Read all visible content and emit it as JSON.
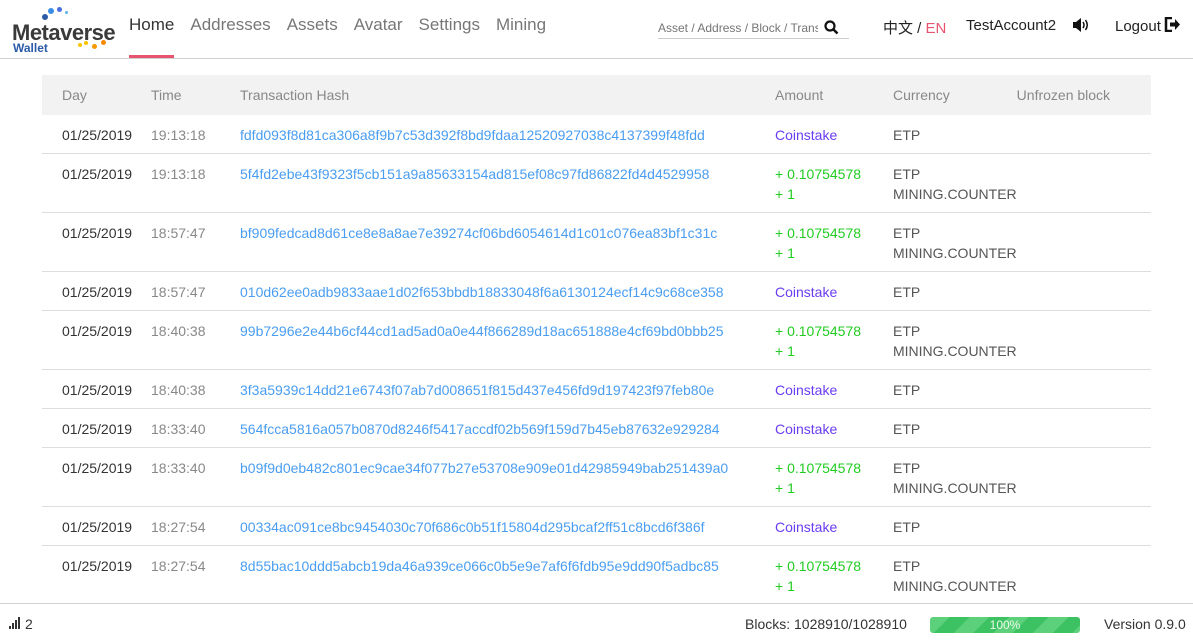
{
  "header": {
    "logo_text": "Metaverse",
    "logo_sub": "Wallet",
    "nav": [
      {
        "label": "Home",
        "active": true
      },
      {
        "label": "Addresses"
      },
      {
        "label": "Assets"
      },
      {
        "label": "Avatar"
      },
      {
        "label": "Settings"
      },
      {
        "label": "Mining"
      }
    ],
    "search_placeholder": "Asset / Address / Block / Transaction",
    "lang_zh": "中文",
    "lang_sep": " / ",
    "lang_en": "EN",
    "account": "TestAccount2",
    "logout": "Logout",
    "accent": "#e8546f"
  },
  "table": {
    "columns": [
      "Day",
      "Time",
      "Transaction Hash",
      "Amount",
      "Currency",
      "Unfrozen block"
    ],
    "rows": [
      {
        "day": "01/25/2019",
        "time": "19:13:18",
        "hash": "fdfd093f8d81ca306a8f9b7c53d392f8bd9fdaa12520927038c4137399f48fdd",
        "amounts": [
          "Coinstake"
        ],
        "currencies": [
          "ETP"
        ]
      },
      {
        "day": "01/25/2019",
        "time": "19:13:18",
        "hash": "5f4fd2ebe43f9323f5cb151a9a85633154ad815ef08c97fd86822fd4d4529958",
        "amounts": [
          "+ 0.10754578",
          "+ 1"
        ],
        "currencies": [
          "ETP",
          "MINING.COUNTER"
        ]
      },
      {
        "day": "01/25/2019",
        "time": "18:57:47",
        "hash": "bf909fedcad8d61ce8e8a8ae7e39274cf06bd6054614d1c01c076ea83bf1c31c",
        "amounts": [
          "+ 0.10754578",
          "+ 1"
        ],
        "currencies": [
          "ETP",
          "MINING.COUNTER"
        ]
      },
      {
        "day": "01/25/2019",
        "time": "18:57:47",
        "hash": "010d62ee0adb9833aae1d02f653bbdb18833048f6a6130124ecf14c9c68ce358",
        "amounts": [
          "Coinstake"
        ],
        "currencies": [
          "ETP"
        ]
      },
      {
        "day": "01/25/2019",
        "time": "18:40:38",
        "hash": "99b7296e2e44b6cf44cd1ad5ad0a0e44f866289d18ac651888e4cf69bd0bbb25",
        "amounts": [
          "+ 0.10754578",
          "+ 1"
        ],
        "currencies": [
          "ETP",
          "MINING.COUNTER"
        ]
      },
      {
        "day": "01/25/2019",
        "time": "18:40:38",
        "hash": "3f3a5939c14dd21e6743f07ab7d008651f815d437e456fd9d197423f97feb80e",
        "amounts": [
          "Coinstake"
        ],
        "currencies": [
          "ETP"
        ]
      },
      {
        "day": "01/25/2019",
        "time": "18:33:40",
        "hash": "564fcca5816a057b0870d8246f5417accdf02b569f159d7b45eb87632e929284",
        "amounts": [
          "Coinstake"
        ],
        "currencies": [
          "ETP"
        ]
      },
      {
        "day": "01/25/2019",
        "time": "18:33:40",
        "hash": "b09f9d0eb482c801ec9cae34f077b27e53708e909e01d42985949bab251439a0",
        "amounts": [
          "+ 0.10754578",
          "+ 1"
        ],
        "currencies": [
          "ETP",
          "MINING.COUNTER"
        ]
      },
      {
        "day": "01/25/2019",
        "time": "18:27:54",
        "hash": "00334ac091ce8bc9454030c70f686c0b51f15804d295bcaf2ff51c8bcd6f386f",
        "amounts": [
          "Coinstake"
        ],
        "currencies": [
          "ETP"
        ]
      },
      {
        "day": "01/25/2019",
        "time": "18:27:54",
        "hash": "8d55bac10ddd5abcb19da46a939ce066c0b5e9e7af6f6fdb95e9dd90f5adbc85",
        "amounts": [
          "+ 0.10754578",
          "+ 1"
        ],
        "currencies": [
          "ETP",
          "MINING.COUNTER"
        ]
      }
    ]
  },
  "footer": {
    "peers": "2",
    "blocks": "Blocks: 1028910/1028910",
    "sync_percent": 100,
    "sync_label": "100%",
    "version": "Version 0.9.0"
  }
}
